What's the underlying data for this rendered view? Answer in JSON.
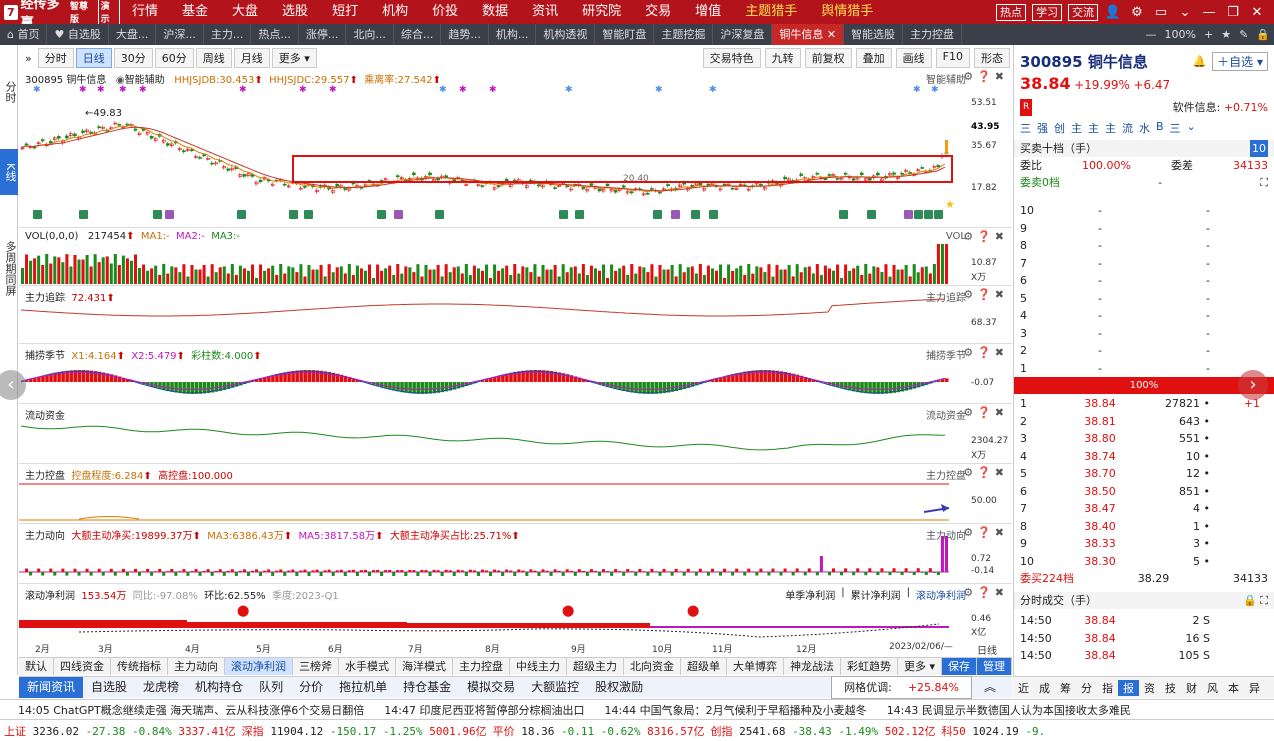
{
  "app": {
    "logo_text": "经传多赢",
    "edition": "智尊版",
    "mode": "演示"
  },
  "topmenu": [
    "行情",
    "基金",
    "大盘",
    "选股",
    "短打",
    "机构",
    "价投",
    "数据",
    "资讯",
    "研究院",
    "交易",
    "增值"
  ],
  "topmenu_hl": [
    "主题猎手",
    "舆情猎手"
  ],
  "topright": {
    "hot": "热点",
    "learn": "学习",
    "talk": "交流"
  },
  "tabs": [
    "首页",
    "自选股",
    "大盘...",
    "沪深...",
    "主力...",
    "热点...",
    "涨停...",
    "北向...",
    "综合...",
    "趋势...",
    "机构...",
    "机构透视",
    "智能盯盘",
    "主题挖掘",
    "沪深复盘",
    "铜牛信息",
    "智能选股",
    "主力控盘"
  ],
  "tab_active_index": 15,
  "tab_zoom": "100%",
  "leftnav": [
    "分时",
    "K线",
    "多周期同屏"
  ],
  "periods": [
    "分时",
    "日线",
    "30分",
    "60分",
    "周线",
    "月线",
    "更多"
  ],
  "period_active": 1,
  "chart_tools": [
    "交易特色",
    "九转",
    "前复权",
    "叠加",
    "画线",
    "F10",
    "形态"
  ],
  "kline": {
    "code_name": "300895 铜牛信息",
    "assist": "智能辅助",
    "hh_label": "HHJSJDB:30.453",
    "hh2_label": "HHJSJDC:29.557",
    "ratio_label": "乘离率:27.542",
    "hi_label": "49.83",
    "lo_label": "20.40",
    "right_title": "智能辅助",
    "y_ticks": [
      "53.51",
      "43.95",
      "35.67",
      "17.82"
    ]
  },
  "vol": {
    "title": "VOL(0,0,0)",
    "val": "217454",
    "ma1": "MA1:-",
    "ma2": "MA2:-",
    "ma3": "MA3:-",
    "right_title": "VOL",
    "y_tick": "10.87",
    "unit": "X万"
  },
  "zlzz": {
    "title": "主力追踪",
    "val": "72.431",
    "right_title": "主力追踪",
    "y_tick": "68.37"
  },
  "bzjj": {
    "title": "捕捞季节",
    "x1": "X1:4.164",
    "x2": "X2:5.479",
    "cai": "彩柱数:4.000",
    "right_title": "捕捞季节",
    "y_tick": "-0.07"
  },
  "ldzj": {
    "title": "流动资金",
    "right_title": "流动资金",
    "y_tick": "2304.27",
    "unit": "X万"
  },
  "zlkp": {
    "title": "主力控盘",
    "kp": "控盘程度:6.284",
    "gk": "高控盘:100.000",
    "right_title": "主力控盘",
    "y_tick": "50.00"
  },
  "zldx": {
    "title": "主力动向",
    "a": "大额主动净买:19899.37万",
    "b": "MA3:6386.43万",
    "c": "MA5:3817.58万",
    "d": "大额主动净买占比:25.71%",
    "right_title": "主力动向",
    "y_tick1": "0.72",
    "y_tick2": "-0.14"
  },
  "gdlr": {
    "title": "滚动净利润",
    "val": "153.54万",
    "tb": "同比:-97.08%",
    "hb": "环比:62.55%",
    "q": "季度:2023-Q1",
    "tabs": [
      "单季净利润",
      "累计净利润",
      "滚动净利润"
    ],
    "y_tick": "0.46",
    "unit": "X亿"
  },
  "xaxis": {
    "months": [
      "2月",
      "3月",
      "4月",
      "5月",
      "6月",
      "7月",
      "8月",
      "9月",
      "10月",
      "11月",
      "12月"
    ],
    "date": "2023/02/06/—",
    "period": "日线"
  },
  "indicator_tabs": [
    "默认",
    "四线资金",
    "传统指标",
    "主力动向",
    "滚动净利润",
    "三榜斧",
    "水手模式",
    "海洋模式",
    "主力控盘",
    "中线主力",
    "超级主力",
    "北向资金",
    "超级单",
    "大单博弈",
    "神龙战法",
    "彩虹趋势",
    "更多"
  ],
  "indicator_active": 4,
  "indicator_btns": [
    "保存",
    "管理"
  ],
  "bottom_tabs": [
    "新闻资讯",
    "自选股",
    "龙虎榜",
    "机构持仓",
    "队列",
    "分价",
    "拖拉机单",
    "持仓基金",
    "模拟交易",
    "大额监控",
    "股权激励"
  ],
  "bottom_opt": {
    "label": "网格优调:",
    "val": "+25.84%"
  },
  "right": {
    "code": "300895",
    "name": "铜牛信息",
    "price": "38.84",
    "pct": "+19.99%",
    "chg": "+6.47",
    "soft_label": "软件信息:",
    "soft_val": "+0.71%",
    "tags": [
      "三",
      "强",
      "创",
      "主",
      "主",
      "主",
      "流",
      "水",
      "B",
      "三"
    ],
    "book_title": "买卖十档（手）",
    "book_num": "10",
    "weibi_label": "委比",
    "weibi_val": "100.00%",
    "weicha_label": "委差",
    "weicha_val": "34133",
    "wsell_label": "委卖0档",
    "wsell_val": "-",
    "full": "100%",
    "wbuy_label": "委买224档",
    "wbuy_price": "38.29",
    "wbuy_vol": "34133",
    "trade_title": "分时成交（手）"
  },
  "asks": [
    {
      "lv": "10",
      "p": "-",
      "v": "-"
    },
    {
      "lv": "9",
      "p": "-",
      "v": "-"
    },
    {
      "lv": "8",
      "p": "-",
      "v": "-"
    },
    {
      "lv": "7",
      "p": "-",
      "v": "-"
    },
    {
      "lv": "6",
      "p": "-",
      "v": "-"
    },
    {
      "lv": "5",
      "p": "-",
      "v": "-"
    },
    {
      "lv": "4",
      "p": "-",
      "v": "-"
    },
    {
      "lv": "3",
      "p": "-",
      "v": "-"
    },
    {
      "lv": "2",
      "p": "-",
      "v": "-"
    },
    {
      "lv": "1",
      "p": "-",
      "v": "-"
    }
  ],
  "bids": [
    {
      "lv": "1",
      "p": "38.84",
      "v": "27821",
      "x": "+1"
    },
    {
      "lv": "2",
      "p": "38.81",
      "v": "643",
      "x": ""
    },
    {
      "lv": "3",
      "p": "38.80",
      "v": "551",
      "x": ""
    },
    {
      "lv": "4",
      "p": "38.74",
      "v": "10",
      "x": ""
    },
    {
      "lv": "5",
      "p": "38.70",
      "v": "12",
      "x": ""
    },
    {
      "lv": "6",
      "p": "38.50",
      "v": "851",
      "x": ""
    },
    {
      "lv": "7",
      "p": "38.47",
      "v": "4",
      "x": ""
    },
    {
      "lv": "8",
      "p": "38.40",
      "v": "1",
      "x": ""
    },
    {
      "lv": "9",
      "p": "38.33",
      "v": "3",
      "x": ""
    },
    {
      "lv": "10",
      "p": "38.30",
      "v": "5",
      "x": ""
    }
  ],
  "trades": [
    {
      "t": "14:50",
      "p": "38.84",
      "v": "2 S"
    },
    {
      "t": "14:50",
      "p": "38.84",
      "v": "16 S"
    },
    {
      "t": "14:50",
      "p": "38.84",
      "v": "105 S"
    }
  ],
  "right_tabs": [
    "近",
    "成",
    "筹",
    "分",
    "指",
    "报",
    "资",
    "技",
    "财",
    "风",
    "本",
    "异"
  ],
  "right_tab_active": 5,
  "news": [
    "14:05 ChatGPT概念继续走强 海天瑞声、云从科技涨停6个交易日翻倍",
    "14:47 印度尼西亚将暂停部分棕榈油出口",
    "14:44 中国气象局：2月气候利于早稻播种及小麦越冬",
    "14:43 民调显示半数德国人认为本国接收太多难民"
  ],
  "indices": [
    {
      "n": "上证",
      "v": "3236.02",
      "c": "-27.38",
      "p": "-0.84%",
      "a": "3337.41亿"
    },
    {
      "n": "深指",
      "v": "11904.12",
      "c": "-150.17",
      "p": "-1.25%",
      "a": "5001.96亿"
    },
    {
      "n": "平价",
      "v": "18.36",
      "c": "-0.11",
      "p": "-0.62%",
      "a": "8316.57亿"
    },
    {
      "n": "创指",
      "v": "2541.68",
      "c": "-38.43",
      "p": "-1.49%",
      "a": "502.12亿"
    },
    {
      "n": "科50",
      "v": "1024.19",
      "c": "-9.",
      "p": "",
      "a": ""
    }
  ]
}
